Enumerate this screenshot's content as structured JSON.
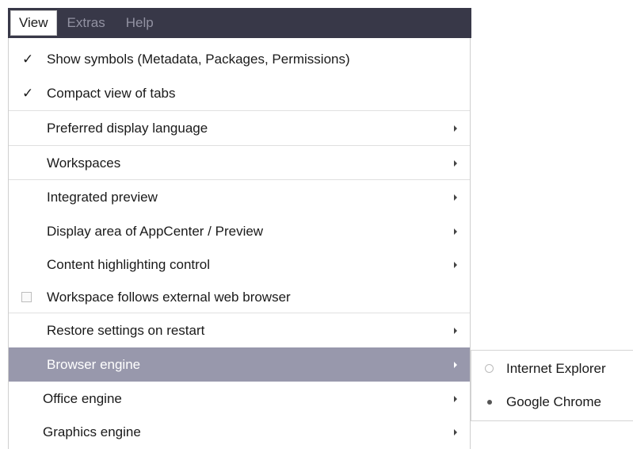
{
  "menubar": {
    "items": [
      {
        "label": "View",
        "active": true
      },
      {
        "label": "Extras",
        "active": false
      },
      {
        "label": "Help",
        "active": false
      }
    ]
  },
  "view_menu": {
    "items": [
      {
        "label": "Show symbols (Metadata, Packages, Permissions)",
        "state": "checked",
        "submenu": false
      },
      {
        "label": "Compact view of tabs",
        "state": "checked",
        "submenu": false
      },
      {
        "label": "Preferred display language",
        "state": "none",
        "submenu": true
      },
      {
        "label": "Workspaces",
        "state": "none",
        "submenu": true
      },
      {
        "label": "Integrated preview",
        "state": "none",
        "submenu": true
      },
      {
        "label": "Display area of AppCenter / Preview",
        "state": "none",
        "submenu": true
      },
      {
        "label": "Content highlighting control",
        "state": "none",
        "submenu": true
      },
      {
        "label": "Workspace follows external web browser",
        "state": "unchecked-box",
        "submenu": false
      },
      {
        "label": "Restore settings on restart",
        "state": "none",
        "submenu": true
      },
      {
        "label": "Browser engine",
        "state": "none",
        "submenu": true,
        "highlighted": true
      },
      {
        "label": "Office engine",
        "state": "none",
        "submenu": true
      },
      {
        "label": "Graphics engine",
        "state": "none",
        "submenu": true
      }
    ],
    "check_glyph": "✓"
  },
  "browser_engine_submenu": {
    "items": [
      {
        "label": "Internet Explorer",
        "selected": false
      },
      {
        "label": "Google Chrome",
        "selected": true
      }
    ]
  },
  "colors": {
    "menubar_bg": "#383848",
    "menubar_text_inactive": "#9292a2",
    "highlight_bg": "#9898ac",
    "highlight_text": "#ffffff"
  }
}
